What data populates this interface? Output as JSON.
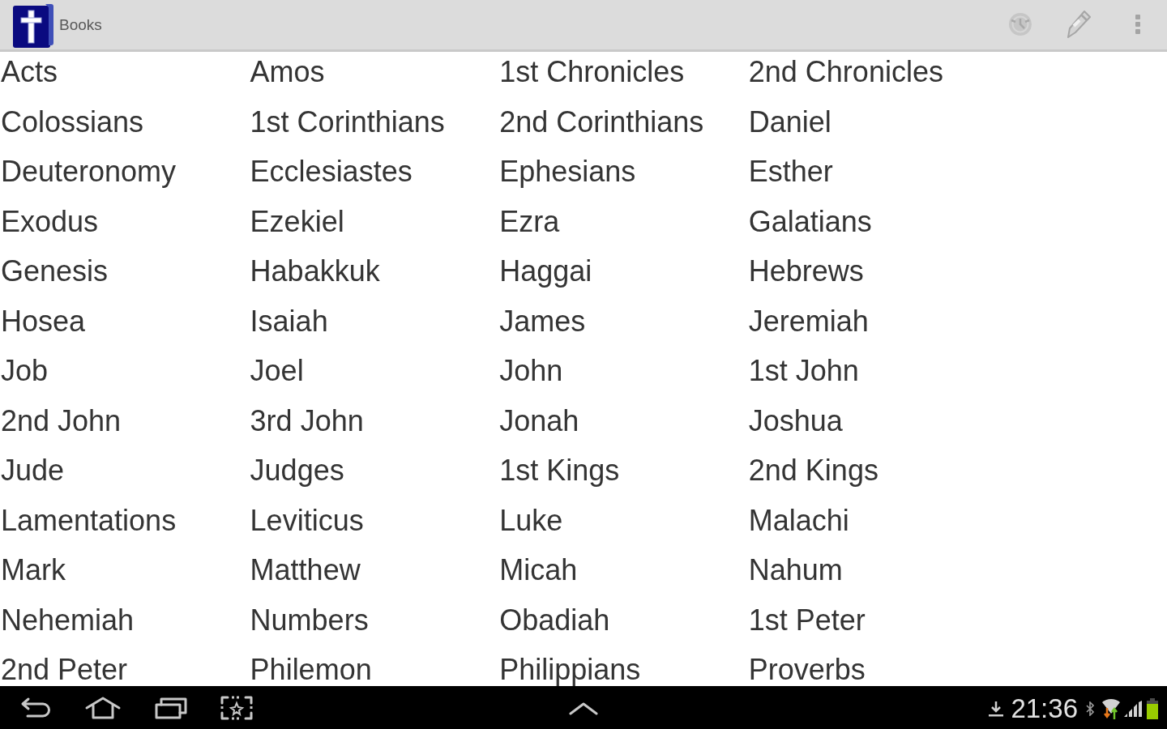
{
  "action_bar": {
    "title": "Books"
  },
  "books": [
    "Acts",
    "Amos",
    "1st Chronicles",
    "2nd Chronicles",
    "Colossians",
    "1st Corinthians",
    "2nd Corinthians",
    "Daniel",
    "Deuteronomy",
    "Ecclesiastes",
    "Ephesians",
    "Esther",
    "Exodus",
    "Ezekiel",
    "Ezra",
    "Galatians",
    "Genesis",
    "Habakkuk",
    "Haggai",
    "Hebrews",
    "Hosea",
    "Isaiah",
    "James",
    "Jeremiah",
    "Job",
    "Joel",
    "John",
    "1st John",
    "2nd John",
    "3rd John",
    "Jonah",
    "Joshua",
    "Jude",
    "Judges",
    "1st Kings",
    "2nd Kings",
    "Lamentations",
    "Leviticus",
    "Luke",
    "Malachi",
    "Mark",
    "Matthew",
    "Micah",
    "Nahum",
    "Nehemiah",
    "Numbers",
    "Obadiah",
    "1st Peter",
    "2nd Peter",
    "Philemon",
    "Philippians",
    "Proverbs"
  ],
  "status_bar": {
    "time": "21:36"
  }
}
